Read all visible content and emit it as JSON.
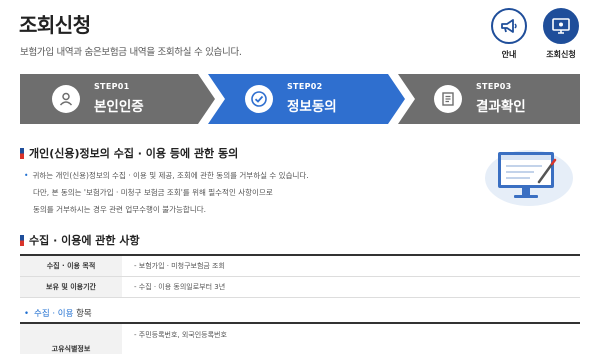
{
  "header": {
    "title": "조회신청",
    "subtitle": "보험가입 내역과 숨은보험금 내역을 조회하실 수 있습니다."
  },
  "top_buttons": [
    {
      "label": "안내",
      "icon": "megaphone-icon"
    },
    {
      "label": "조회신청",
      "icon": "monitor-icon"
    }
  ],
  "steps": [
    {
      "num": "STEP01",
      "name": "본인인증",
      "icon": "person-icon",
      "active": false
    },
    {
      "num": "STEP02",
      "name": "정보동의",
      "icon": "check-circle-icon",
      "active": true
    },
    {
      "num": "STEP03",
      "name": "결과확인",
      "icon": "document-icon",
      "active": false
    }
  ],
  "consent_section": {
    "title": "개인(신용)정보의 수집 · 이용 등에 관한 동의",
    "lines": [
      "귀하는 개인(신용)정보의 수집 · 이용 및 제공, 조회에 관한 동의를 거부하실 수 있습니다.",
      "다만, 본 동의는 '보험가입 · 미청구 보험금 조회'를 위해 필수적인 사항이므로",
      "동의를 거부하시는 경우 관련 업무수행이 불가능합니다."
    ]
  },
  "collection_section": {
    "title": "수집 · 이용에 관한 사항",
    "rows": [
      {
        "label": "수집 · 이용 목적",
        "value": "- 보험가입 · 미청구보험금 조회"
      },
      {
        "label": "보유 및 이용기간",
        "value": "- 수집 · 이용 동의일로부터 3년"
      }
    ]
  },
  "items_section": {
    "prefix": "수집 · 이용",
    "suffix": "항목",
    "rows": [
      {
        "label": "고유식별정보",
        "value": "- 주민등록번호, 외국인등록번호"
      }
    ]
  },
  "colors": {
    "primary": "#1f4e9a",
    "active_step": "#2f6fcf",
    "inactive_step": "#6e6e6e",
    "accent_red": "#d9342b"
  }
}
